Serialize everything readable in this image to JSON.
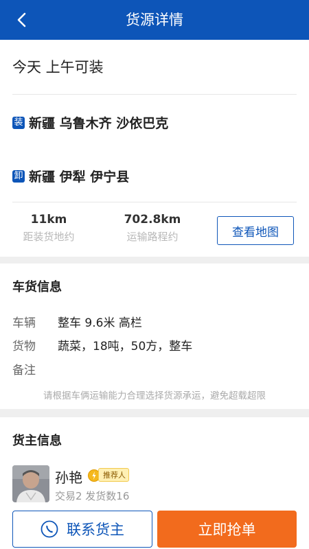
{
  "header": {
    "title": "货源详情"
  },
  "load_time": "今天 上午可装",
  "route": {
    "load_tag": "装",
    "load_address": "新疆 乌鲁木齐 沙依巴克",
    "unload_tag": "卸",
    "unload_address": "新疆 伊犁 伊宁县"
  },
  "stats": {
    "distance_value": "11km",
    "distance_label": "距装货地约",
    "route_value": "702.8km",
    "route_label": "运输路程约",
    "map_button": "查看地图"
  },
  "cargo": {
    "section_title": "车货信息",
    "vehicle_label": "车辆",
    "vehicle_value": "整车 9.6米 高栏",
    "goods_label": "货物",
    "goods_value": "蔬菜，18吨，50方，整车",
    "remark_label": "备注",
    "hint": "请根据车俩运输能力合理选择货源承运，避免超载超限"
  },
  "owner": {
    "section_title": "货主信息",
    "name": "孙艳",
    "badge": "推荐人",
    "stats": "交易2 发货数16"
  },
  "actions": {
    "contact": "联系货主",
    "grab": "立即抢单"
  },
  "colors": {
    "brand": "#0d55b8",
    "accent": "#f26b1d"
  }
}
